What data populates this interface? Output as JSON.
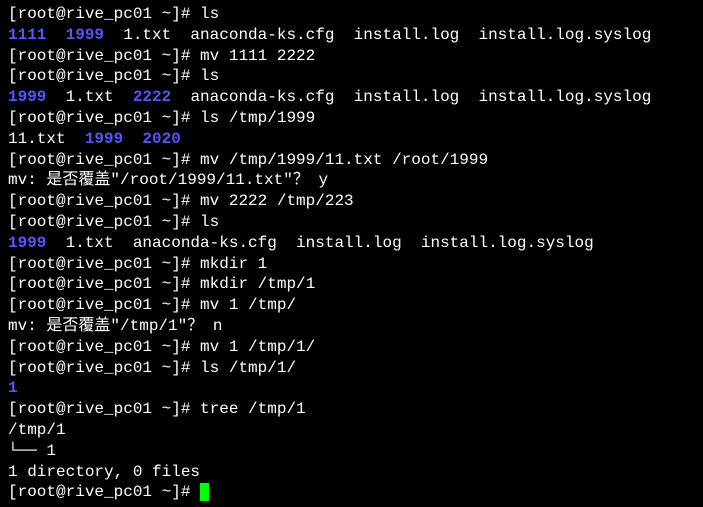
{
  "prompt": "[root@rive_pc01 ~]# ",
  "lines": {
    "l1_cmd": "ls",
    "l2_out": [
      {
        "text": "1111",
        "class": "dir"
      },
      {
        "text": "  ",
        "class": ""
      },
      {
        "text": "1999",
        "class": "dir"
      },
      {
        "text": "  1.txt  anaconda-ks.cfg  install.log  install.log.syslog",
        "class": ""
      }
    ],
    "l3_cmd": "mv 1111 2222",
    "l4_cmd": "ls",
    "l5_out": [
      {
        "text": "1999",
        "class": "dir"
      },
      {
        "text": "  1.txt  ",
        "class": ""
      },
      {
        "text": "2222",
        "class": "dir"
      },
      {
        "text": "  anaconda-ks.cfg  install.log  install.log.syslog",
        "class": ""
      }
    ],
    "l6_cmd": "ls /tmp/1999",
    "l7_out": [
      {
        "text": "11.txt  ",
        "class": ""
      },
      {
        "text": "1999",
        "class": "dir"
      },
      {
        "text": "  ",
        "class": ""
      },
      {
        "text": "2020",
        "class": "dir"
      }
    ],
    "l8_cmd": "mv /tmp/1999/11.txt /root/1999",
    "l9_out": "mv: 是否覆盖\"/root/1999/11.txt\"？ y",
    "l10_cmd": "mv 2222 /tmp/223",
    "l11_cmd": "ls",
    "l12_out": [
      {
        "text": "1999",
        "class": "dir"
      },
      {
        "text": "  1.txt  anaconda-ks.cfg  install.log  install.log.syslog",
        "class": ""
      }
    ],
    "l13_cmd": "mkdir 1",
    "l14_cmd": "mkdir /tmp/1",
    "l15_cmd": "mv 1 /tmp/",
    "l16_out": "mv: 是否覆盖\"/tmp/1\"？ n",
    "l17_cmd": "mv 1 /tmp/1/",
    "l18_cmd": "ls /tmp/1/",
    "l19_out": [
      {
        "text": "1",
        "class": "dir"
      }
    ],
    "l20_cmd": "tree /tmp/1",
    "l21_out": "/tmp/1",
    "l22_out": "└── 1",
    "l23_blank": "",
    "l24_out": "1 directory, 0 files"
  }
}
